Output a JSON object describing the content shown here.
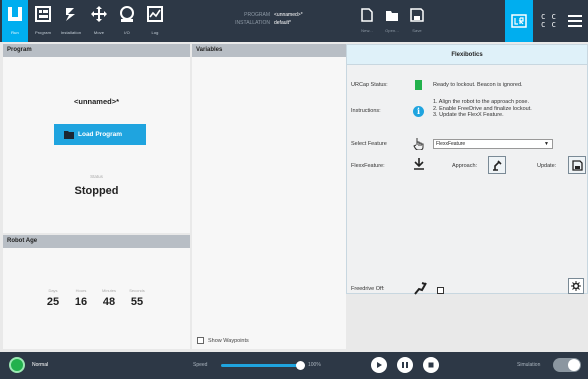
{
  "nav": {
    "items": [
      {
        "label": "Run",
        "icon": "ur-logo-icon"
      },
      {
        "label": "Program",
        "icon": "program-icon"
      },
      {
        "label": "Installation",
        "icon": "installation-icon"
      },
      {
        "label": "Move",
        "icon": "move-icon"
      },
      {
        "label": "I/O",
        "icon": "io-icon"
      },
      {
        "label": "Log",
        "icon": "log-icon"
      }
    ]
  },
  "program_info": {
    "program_label": "PROGRAM",
    "program_value": "<unnamed>*",
    "installation_label": "INSTALLATION",
    "installation_value": "default*"
  },
  "file_tools": [
    {
      "label": "New...",
      "icon": "new-file-icon"
    },
    {
      "label": "Open...",
      "icon": "open-folder-icon"
    },
    {
      "label": "Save",
      "icon": "save-icon"
    }
  ],
  "program_panel": {
    "title": "Program",
    "program_name": "<unnamed>*",
    "load_button": "Load Program",
    "status_caption": "Status",
    "status_value": "Stopped"
  },
  "robot_age": {
    "title": "Robot Age",
    "cells": [
      {
        "caption": "Days",
        "value": "25"
      },
      {
        "caption": "Hours",
        "value": "16"
      },
      {
        "caption": "Minutes",
        "value": "48"
      },
      {
        "caption": "Seconds",
        "value": "55"
      }
    ]
  },
  "variables": {
    "title": "Variables",
    "show_waypoints": "Show Waypoints"
  },
  "flexibotics": {
    "title": "Flexibotics",
    "urcap_status_label": "URCap Status:",
    "urcap_status_text": "Ready to lockout. Beacon is ignored.",
    "urcap_status_color": "#22b14c",
    "instructions_label": "Instructions:",
    "instructions": [
      "1. Align the robot to the approach pose.",
      "2. Enable FreeDrive and finalize lockout.",
      "3. Update the FlexX Feature."
    ],
    "select_feature_label": "Select Feature",
    "select_feature_value": "FlexxFeature",
    "flexxfeature_label": "FlexxFeature:",
    "approach_label": "Approach:",
    "update_label": "Update:",
    "freedrive_label": "Freedrive Off:"
  },
  "footer": {
    "mode": "Normal",
    "speed_label": "Speed",
    "speed_value": "100%",
    "speed_fraction": 1.0,
    "simulation_label": "Simulation",
    "simulation_on": false
  },
  "colors": {
    "topbar": "#2d3846",
    "accent": "#00aeef",
    "status_green": "#22b14c"
  }
}
